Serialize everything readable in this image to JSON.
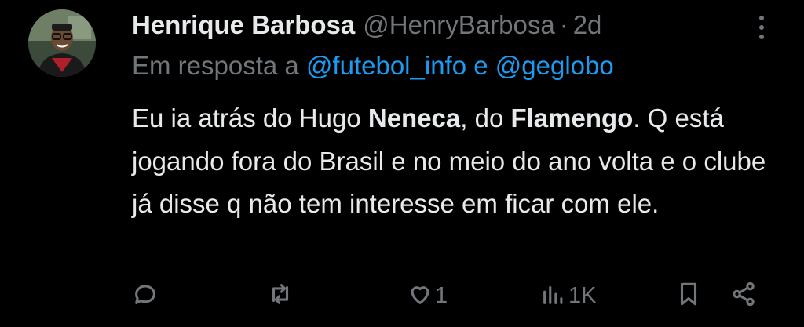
{
  "tweet": {
    "author_name": "Henrique Barbosa",
    "author_handle": "@HenryBarbosa",
    "separator": "·",
    "age": "2d",
    "reply_prefix": "Em resposta a",
    "reply_mention_1": "@futebol_info",
    "reply_conjunction": "e",
    "reply_mention_2": "@geglobo",
    "text_part1": "Eu ia atrás do Hugo ",
    "text_bold1": "Neneca",
    "text_part2": ", do ",
    "text_bold2": "Flamengo",
    "text_part3": ". Q está jogando fora do Brasil e no meio do ano volta e o clube já disse q não tem interesse em ficar com ele."
  },
  "actions": {
    "reply_icon": "comment-icon",
    "retweet_icon": "retweet-icon",
    "like_icon": "heart-icon",
    "like_count": "1",
    "views_icon": "views-icon",
    "views_count": "1K",
    "bookmark_icon": "bookmark-icon",
    "share_icon": "share-icon"
  },
  "colors": {
    "background": "#000000",
    "text": "#e7e9ea",
    "secondary": "#71767b",
    "link": "#1d9bf0"
  }
}
